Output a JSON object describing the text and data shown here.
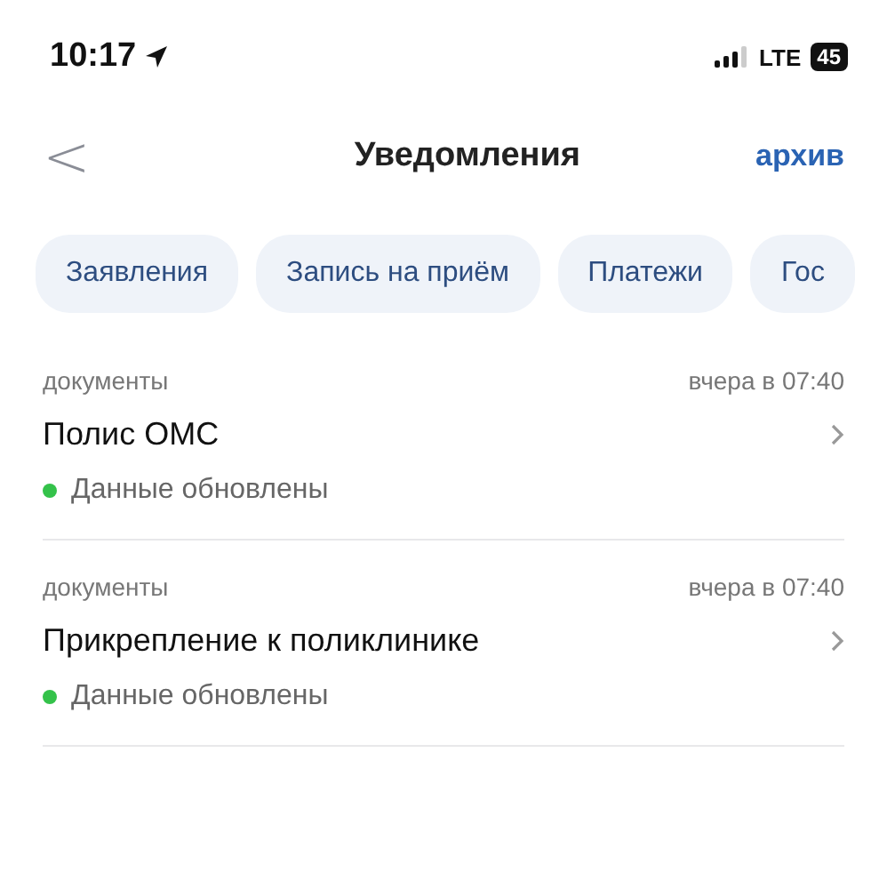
{
  "status_bar": {
    "time": "10:17",
    "network": "LTE",
    "battery": "45"
  },
  "nav": {
    "back": "<",
    "title": "Уведомления",
    "action": "архив"
  },
  "chips": [
    {
      "label": "Заявления",
      "selected": false
    },
    {
      "label": "Запись на приём",
      "selected": false
    },
    {
      "label": "Платежи",
      "selected": false
    },
    {
      "label": "Гос",
      "selected": false
    }
  ],
  "notifications": [
    {
      "category": "документы",
      "time": "вчера в 07:40",
      "title": "Полис ОМС",
      "status": "Данные обновлены",
      "color": "#34c24a"
    },
    {
      "category": "документы",
      "time": "вчера в 07:40",
      "title": "Прикрепление к поликлинике",
      "status": "Данные обновлены",
      "color": "#34c24a"
    }
  ]
}
